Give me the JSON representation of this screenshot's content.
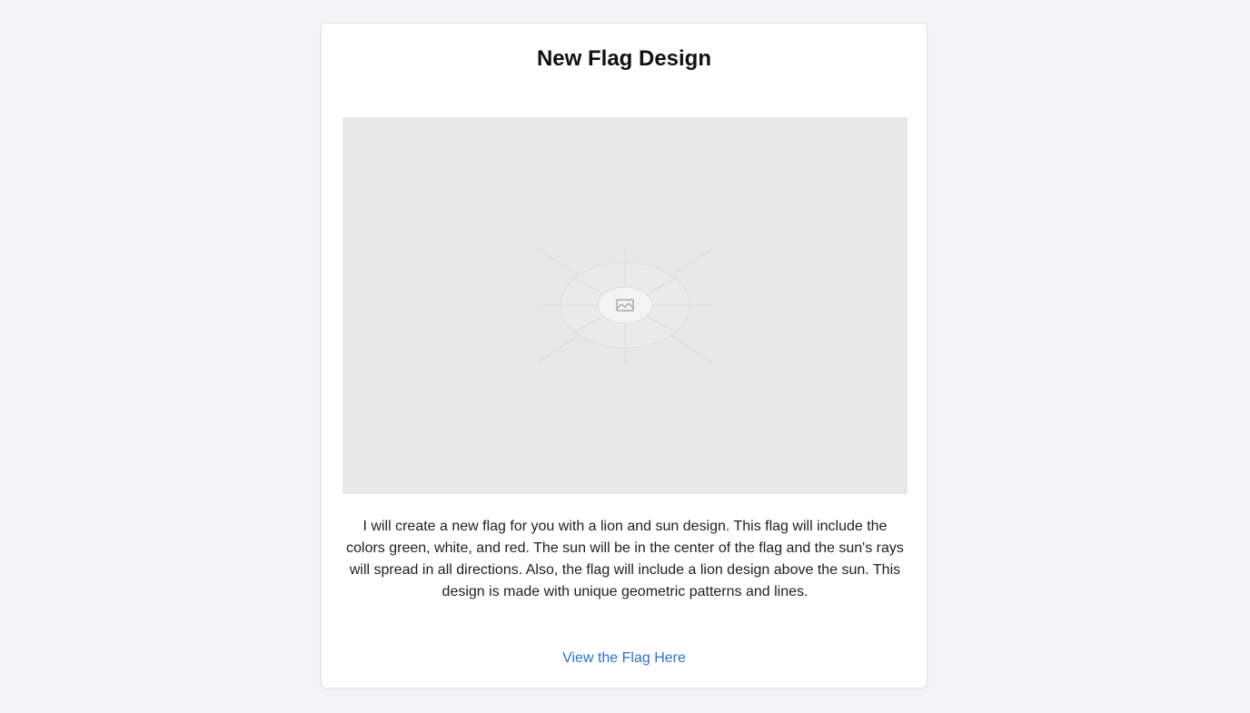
{
  "card": {
    "title": "New Flag Design",
    "image": {
      "icon": "image-icon"
    },
    "description": "I will create a new flag for you with a lion and sun design. This flag will include the colors green, white, and red. The sun will be in the center of the flag and the sun's rays will spread in all directions. Also, the flag will include a lion design above the sun. This design is made with unique geometric patterns and lines.",
    "link_label": "View the Flag Here"
  },
  "colors": {
    "page_background": "#f2f3f5",
    "card_background": "#ffffff",
    "placeholder_background": "#e8e8e8",
    "link": "#2f6fd6"
  }
}
